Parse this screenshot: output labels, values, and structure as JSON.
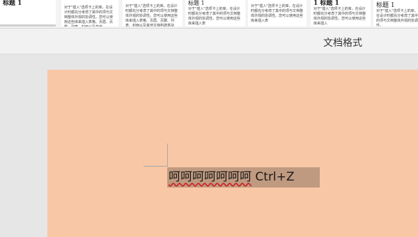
{
  "style_gallery": {
    "items": [
      {
        "heading": "标题 1",
        "body": ""
      },
      {
        "heading": "",
        "body": "对于\"插入\"选项卡上的库，在设计时都充分考虑了其中的项与文档整体外观的协调性。您可以使用这些库来插入表格、页眉、页脚、列表、封面以及其他"
      },
      {
        "heading": "",
        "body": "对于\"插入\"选项卡上的库，在设计时都充分考虑了其中的项与文档整体外观的协调性。您可以使用这些库来插入表格、页眉、页脚、列表、封面以及其他文档构建基块"
      },
      {
        "heading": "标题 1",
        "body": "对于\"插入\"选项卡上的库，在设计时都充分考虑了其中的项与文档整体外观的协调性。您可以使用这些库来插入表"
      },
      {
        "heading": "",
        "body": "对于\"插入\"选项卡上的库，在设计时都充分考虑了其中的项与文档整体外观的协调性。您可以使用这些库来插入表"
      },
      {
        "heading": "1  标题 1",
        "body": "对于\"插入\"选项卡上的库，在设计时都充分考虑了其中的项与文档整体外观的协调性。您可以使用这些库来插入"
      },
      {
        "heading": "标题 1",
        "body": "对于\"插入\"选项卡上的库，在设计时都充分考虑了其中的项与文档整体外观的协调性。"
      }
    ]
  },
  "ribbon": {
    "group_label": "文档格式"
  },
  "document": {
    "selected_text_cjk": "呵呵呵呵呵呵呵",
    "selected_text_shortcut": " Ctrl+Z"
  },
  "colors": {
    "page_background": "#f8c7a5",
    "selection": "#c09a80",
    "spellcheck_underline": "#cc2222"
  }
}
